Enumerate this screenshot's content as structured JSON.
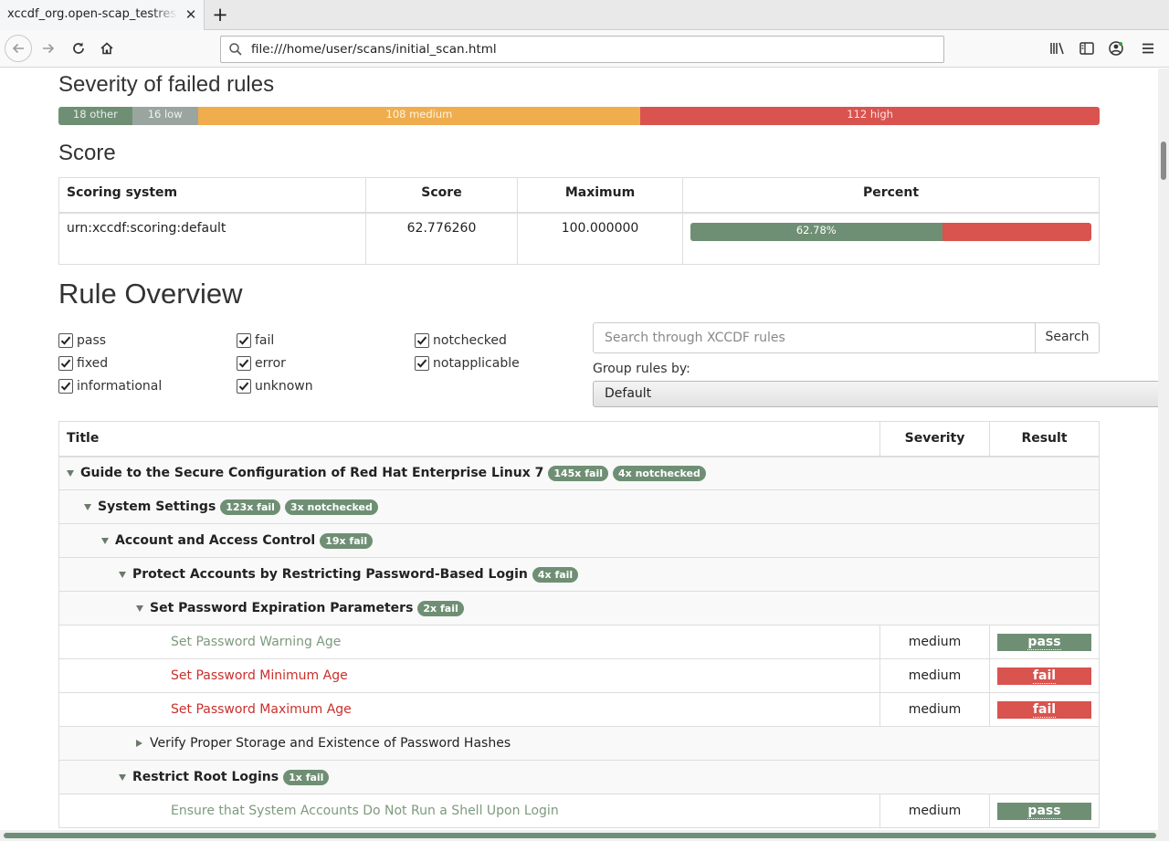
{
  "browser": {
    "tab_title": "xccdf_org.open-scap_testresult_xccdf_org.ssgproject.content_profile",
    "url": "file:///home/user/scans/initial_scan.html"
  },
  "severity": {
    "heading": "Severity of failed rules",
    "segments": [
      {
        "label": "18 other",
        "count": 18,
        "color": "#6f8f74"
      },
      {
        "label": "16 low",
        "count": 16,
        "color": "#9aa5a0"
      },
      {
        "label": "108 medium",
        "count": 108,
        "color": "#efad4d"
      },
      {
        "label": "112 high",
        "count": 112,
        "color": "#d9534f"
      }
    ]
  },
  "score": {
    "heading": "Score",
    "headers": [
      "Scoring system",
      "Score",
      "Maximum",
      "Percent"
    ],
    "row": {
      "system": "urn:xccdf:scoring:default",
      "score": "62.776260",
      "maximum": "100.000000",
      "percent_label": "62.78%",
      "percent": 62.78
    }
  },
  "overview": {
    "heading": "Rule Overview",
    "filters": [
      {
        "label": "pass",
        "checked": true
      },
      {
        "label": "fixed",
        "checked": true
      },
      {
        "label": "informational",
        "checked": true
      },
      {
        "label": "fail",
        "checked": true
      },
      {
        "label": "error",
        "checked": true
      },
      {
        "label": "unknown",
        "checked": true
      },
      {
        "label": "notchecked",
        "checked": true
      },
      {
        "label": "notapplicable",
        "checked": true
      }
    ],
    "search_placeholder": "Search through XCCDF rules",
    "search_button": "Search",
    "group_label": "Group rules by:",
    "group_value": "Default"
  },
  "rules": {
    "headers": [
      "Title",
      "Severity",
      "Result"
    ],
    "rows": [
      {
        "kind": "group",
        "title": "Guide to the Secure Configuration of Red Hat Enterprise Linux 7",
        "badges": [
          "145x fail",
          "4x notchecked"
        ],
        "expanded": true
      },
      {
        "kind": "group",
        "title": "System Settings",
        "badges": [
          "123x fail",
          "3x notchecked"
        ],
        "expanded": true
      },
      {
        "kind": "group",
        "title": "Account and Access Control",
        "badges": [
          "19x fail"
        ],
        "expanded": true
      },
      {
        "kind": "group",
        "title": "Protect Accounts by Restricting Password-Based Login",
        "badges": [
          "4x fail"
        ],
        "expanded": true
      },
      {
        "kind": "group",
        "title": "Set Password Expiration Parameters",
        "badges": [
          "2x fail"
        ],
        "expanded": true
      },
      {
        "kind": "rule",
        "title": "Set Password Warning Age",
        "severity": "medium",
        "result": "pass"
      },
      {
        "kind": "rule",
        "title": "Set Password Minimum Age",
        "severity": "medium",
        "result": "fail"
      },
      {
        "kind": "rule",
        "title": "Set Password Maximum Age",
        "severity": "medium",
        "result": "fail"
      },
      {
        "kind": "group",
        "title": "Verify Proper Storage and Existence of Password Hashes",
        "badges": [],
        "expanded": false
      },
      {
        "kind": "group",
        "title": "Restrict Root Logins",
        "badges": [
          "1x fail"
        ],
        "expanded": true
      },
      {
        "kind": "rule",
        "title": "Ensure that System Accounts Do Not Run a Shell Upon Login",
        "severity": "medium",
        "result": "pass"
      }
    ]
  }
}
